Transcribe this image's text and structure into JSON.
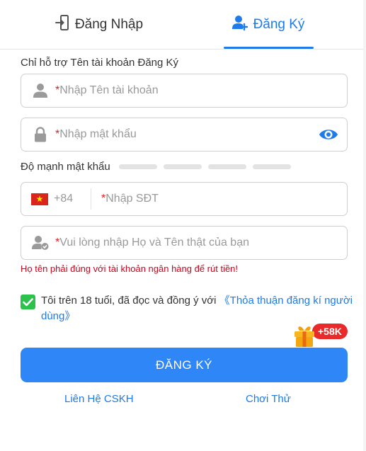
{
  "tabs": {
    "login_label": "Đăng Nhập",
    "register_label": "Đăng Ký"
  },
  "form": {
    "hint": "Chỉ hỗ trợ Tên tài khoản Đăng Ký",
    "required_mark": "*",
    "username_placeholder": "Nhập Tên tài khoản",
    "password_placeholder": "Nhập mật khẩu",
    "strength_label": "Độ mạnh mật khẩu",
    "phone_country_code": "+84",
    "phone_placeholder": "Nhập SĐT",
    "fullname_placeholder": "Vui lòng nhập Họ và Tên thật của bạn",
    "fullname_warning": "Họ tên phải đúng với tài khoản ngân hàng để rút tiền!",
    "agree_text": "Tôi trên 18 tuổi, đã đọc và đồng ý với ",
    "agree_link": "《Thỏa thuận đăng kí người dùng》",
    "agree_checked": true,
    "bonus_badge": "+58K",
    "submit_label": "ĐĂNG KÝ"
  },
  "footer": {
    "support_label": "Liên Hệ CSKH",
    "trial_label": "Chơi Thử"
  },
  "colors": {
    "accent": "#1f7aea",
    "button": "#2f86f6",
    "warning": "#d0021b",
    "checkbox": "#2cc24b"
  },
  "icons": {
    "login_tab": "door-enter-icon",
    "register_tab": "add-user-icon",
    "username": "user-icon",
    "password": "lock-icon",
    "toggle_password": "eye-icon",
    "country": "vietnam-flag-icon",
    "fullname": "verified-user-icon",
    "bonus": "gift-icon"
  }
}
